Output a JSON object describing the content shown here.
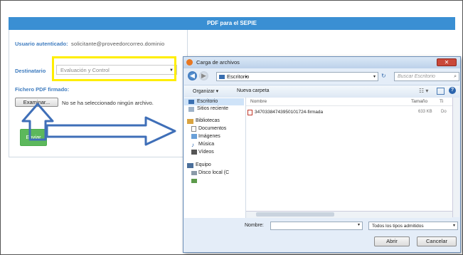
{
  "page": {
    "header_title": "PDF para el SEPIE",
    "user_label": "Usuario autenticado:",
    "user_value": "solicitante@proveedorcorreo.dominio",
    "destinatario_label": "Destinatario",
    "destinatario_value": "Evaluación y Control",
    "file_label": "Fichero PDF firmado:",
    "browse_label": "Examinar...",
    "no_file_text": "No se ha seleccionado ningún archivo.",
    "send_label": "Enviar"
  },
  "dialog": {
    "title": "Carga de archivos",
    "address": "Escritorio",
    "search_placeholder": "Buscar Escritorio",
    "organize_label": "Organizar",
    "new_folder_label": "Nueva carpeta",
    "nav_items": [
      "Escritorio",
      "Sitios reciente",
      "Bibliotecas",
      "Documentos",
      "Imágenes",
      "Música",
      "Vídeos",
      "Equipo",
      "Disco local (C"
    ],
    "columns": [
      "Nombre",
      "Tamaño",
      "Ti"
    ],
    "files": [
      {
        "name": "34703384743950101724-firmada",
        "size": "633 KB",
        "type": "Do"
      }
    ],
    "filename_label": "Nombre:",
    "filetype_value": "Todos los tipos admitidos",
    "open_label": "Abrir",
    "cancel_label": "Cancelar"
  },
  "colors": {
    "header_blue": "#3a8fd3",
    "highlight_yellow": "#ffee00",
    "arrow_blue": "#3f6fb8",
    "send_green": "#5cb85c"
  }
}
